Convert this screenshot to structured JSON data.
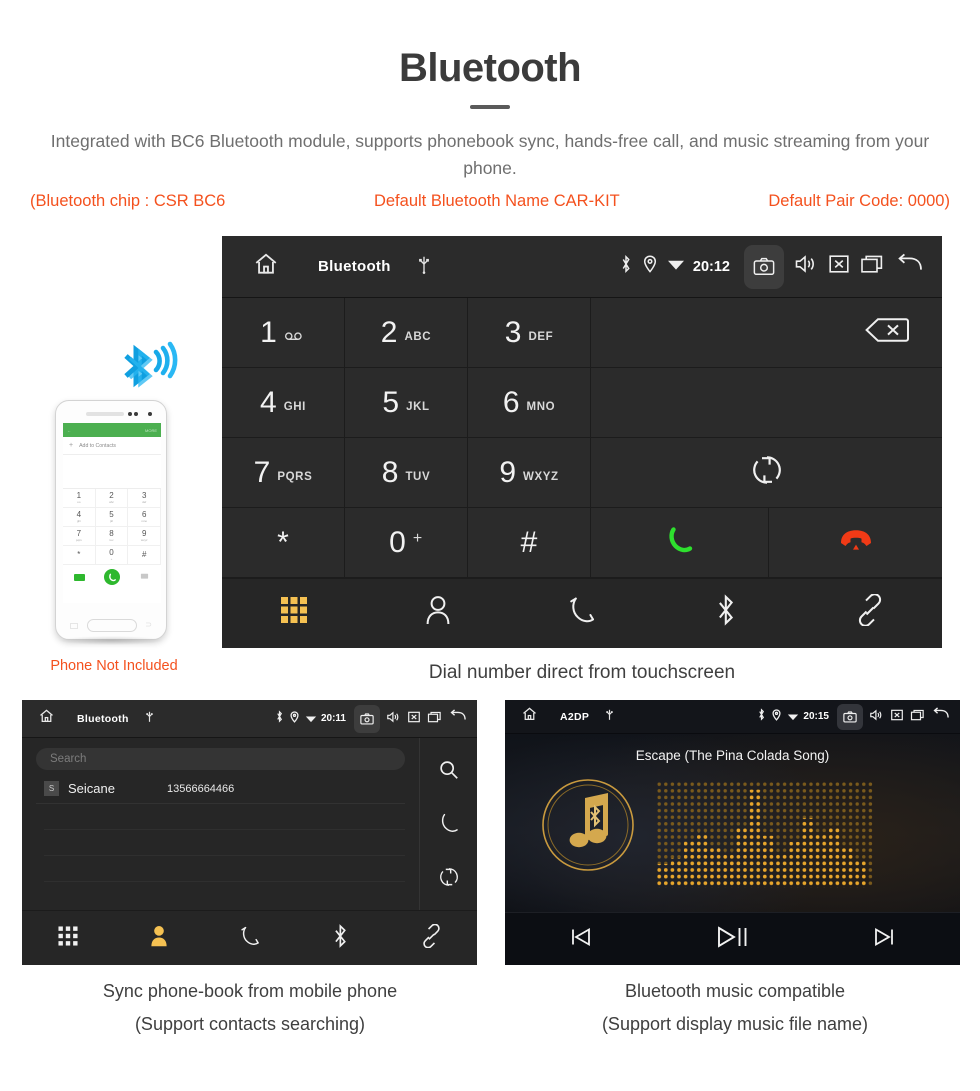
{
  "header": {
    "title": "Bluetooth",
    "description": "Integrated with BC6 Bluetooth module, supports phonebook sync, hands-free call, and music streaming from your phone.",
    "specs": [
      "(Bluetooth chip : CSR BC6",
      "Default Bluetooth Name CAR-KIT",
      "Default Pair Code: 0000)"
    ],
    "accent_color": "#f4511e",
    "title_color": "#3b3b3b"
  },
  "dialer_screen": {
    "statusbar": {
      "home_icon": "home-icon",
      "title": "Bluetooth",
      "usb_icon": "usb-icon",
      "bluetooth_icon": "bluetooth-icon",
      "location_icon": "location-icon",
      "wifi_icon": "wifi-icon",
      "time": "20:12",
      "camera_icon": "camera-icon",
      "volume_icon": "volume-icon",
      "close_icon": "close-box-icon",
      "recents_icon": "recent-apps-icon",
      "back_icon": "back-arrow-icon"
    },
    "keys": [
      {
        "digit": "1",
        "sub": "",
        "icon": "voicemail-icon"
      },
      {
        "digit": "2",
        "sub": "ABC",
        "icon": ""
      },
      {
        "digit": "3",
        "sub": "DEF",
        "icon": ""
      },
      {
        "digit": "4",
        "sub": "GHI",
        "icon": ""
      },
      {
        "digit": "5",
        "sub": "JKL",
        "icon": ""
      },
      {
        "digit": "6",
        "sub": "MNO",
        "icon": ""
      },
      {
        "digit": "7",
        "sub": "PQRS",
        "icon": ""
      },
      {
        "digit": "8",
        "sub": "TUV",
        "icon": ""
      },
      {
        "digit": "9",
        "sub": "WXYZ",
        "icon": ""
      },
      {
        "digit": "*",
        "sub": "",
        "icon": ""
      },
      {
        "digit": "0",
        "sub": "+",
        "icon": ""
      },
      {
        "digit": "#",
        "sub": "",
        "icon": ""
      }
    ],
    "actions": {
      "backspace_icon": "backspace-icon",
      "transfer_icon": "call-transfer-icon",
      "call_icon": "call-answer-icon",
      "hangup_icon": "call-end-icon",
      "call_color": "#2ee02e",
      "hangup_color": "#f03a16"
    },
    "navbar": [
      {
        "icon": "keypad-icon",
        "active": true
      },
      {
        "icon": "contacts-icon",
        "active": false
      },
      {
        "icon": "call-history-icon",
        "active": false
      },
      {
        "icon": "bluetooth-icon",
        "active": false
      },
      {
        "icon": "unlink-icon",
        "active": false
      }
    ],
    "active_color": "#f5c152",
    "caption": "Dial number direct from touchscreen"
  },
  "phone_mock": {
    "appbar_back_icon": "back-arrow-icon",
    "appbar_more": "MORE",
    "add_contacts_label": "Add to Contacts",
    "add_icon": "plus-icon",
    "keys": [
      {
        "digit": "1",
        "sub": "oo"
      },
      {
        "digit": "2",
        "sub": "abc"
      },
      {
        "digit": "3",
        "sub": "def"
      },
      {
        "digit": "4",
        "sub": "ghi"
      },
      {
        "digit": "5",
        "sub": "jkl"
      },
      {
        "digit": "6",
        "sub": "mno"
      },
      {
        "digit": "7",
        "sub": "pqrs"
      },
      {
        "digit": "8",
        "sub": "tuv"
      },
      {
        "digit": "9",
        "sub": "wxyz"
      },
      {
        "digit": "*",
        "sub": ""
      },
      {
        "digit": "0",
        "sub": "+"
      },
      {
        "digit": "#",
        "sub": ""
      }
    ],
    "video_icon": "video-call-icon",
    "call_icon": "call-answer-icon",
    "keyboard_icon": "keyboard-icon",
    "bluetooth_wave_icon": "bluetooth-signal-icon",
    "note": "Phone Not Included",
    "note_color": "#f4511e"
  },
  "phonebook_screen": {
    "statusbar": {
      "title": "Bluetooth",
      "time": "20:11"
    },
    "search_placeholder": "Search",
    "contacts": [
      {
        "initial": "S",
        "name": "Seicane",
        "number": "13566664466"
      }
    ],
    "side_icons": [
      "search-icon",
      "call-icon",
      "sync-icon"
    ],
    "navbar": [
      {
        "icon": "keypad-icon",
        "active": false
      },
      {
        "icon": "contacts-icon",
        "active": true
      },
      {
        "icon": "call-history-icon",
        "active": false
      },
      {
        "icon": "bluetooth-icon",
        "active": false
      },
      {
        "icon": "unlink-icon",
        "active": false
      }
    ],
    "caption_line1": "Sync phone-book from mobile phone",
    "caption_line2": "(Support contacts searching)"
  },
  "music_screen": {
    "statusbar": {
      "title": "A2DP",
      "time": "20:15"
    },
    "song_title": "Escape (The Pina Colada Song)",
    "album_icon": "music-note-bluetooth-icon",
    "equalizer_icon": "equalizer-visualizer",
    "controls": [
      {
        "icon": "previous-track-icon"
      },
      {
        "icon": "play-pause-icon"
      },
      {
        "icon": "next-track-icon"
      }
    ],
    "gold_color": "#d9a441",
    "caption_line1": "Bluetooth music compatible",
    "caption_line2": "(Support display music file name)"
  }
}
